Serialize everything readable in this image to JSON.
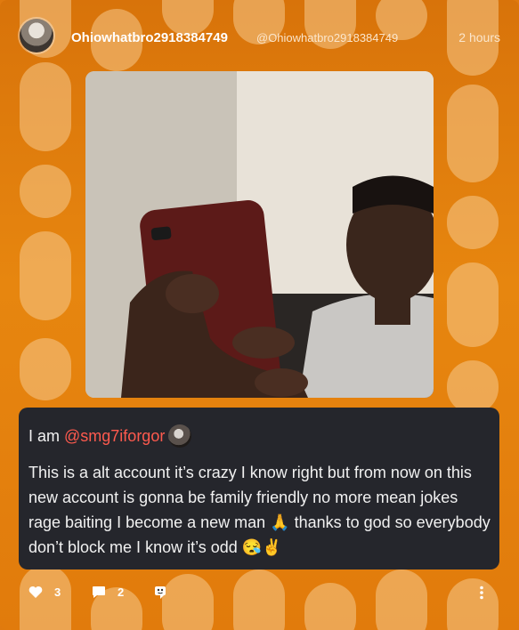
{
  "post": {
    "username": "Ohiowhatbro2918384749",
    "handle": "@Ohiowhatbro2918384749",
    "time": "2 hours",
    "caption_prefix": "I am ",
    "mention": "@smg7iforgor",
    "body": "This is a alt account it’s crazy I know right but from now on this new account is gonna be family friendly no more mean jokes rage baiting I become a new man 🙏 thanks to god so everybody don’t block me I know it’s odd 😪✌️"
  },
  "footer": {
    "likes": "3",
    "comments": "2"
  },
  "icons": {
    "like": "heart-icon",
    "comment": "speech-bubble-icon",
    "share": "share-icon",
    "more": "kebab-menu-icon"
  },
  "colors": {
    "background": "#e07a0e",
    "caption_bg": "#25262c",
    "mention": "#ff5a4e"
  }
}
